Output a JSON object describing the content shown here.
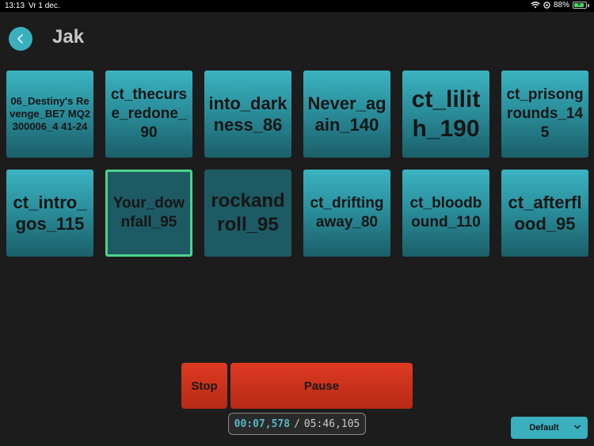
{
  "statusbar": {
    "time": "13:13",
    "date": "Vr 1 dec.",
    "battery_percent_label": "88%",
    "battery_level": 0.88
  },
  "header": {
    "title": "Jak"
  },
  "tiles": [
    {
      "label": "06_Destiny's Revenge_BE7 MQ2300006_4 41-24",
      "state": "normal"
    },
    {
      "label": "ct_thecurse_redone_90",
      "state": "normal"
    },
    {
      "label": "into_darkness_86",
      "state": "normal"
    },
    {
      "label": "Never_again_140",
      "state": "normal"
    },
    {
      "label": "ct_lilith_190",
      "state": "normal"
    },
    {
      "label": "ct_prisongrounds_145",
      "state": "normal"
    },
    {
      "label": "ct_intro_gos_115",
      "state": "normal"
    },
    {
      "label": "Your_downfall_95",
      "state": "selected"
    },
    {
      "label": "rockandroll_95",
      "state": "dim"
    },
    {
      "label": "ct_driftingaway_80",
      "state": "normal"
    },
    {
      "label": "ct_bloodbound_110",
      "state": "normal"
    },
    {
      "label": "ct_afterflood_95",
      "state": "normal"
    }
  ],
  "transport": {
    "stop_label": "Stop",
    "pause_label": "Pause",
    "elapsed": "00:07,578",
    "separator": "/",
    "total": "05:46,105"
  },
  "preset": {
    "selected": "Default"
  },
  "colors": {
    "accent": "#3aafbe",
    "stop_red": "#d2321c",
    "selected_border": "#4bd38d"
  }
}
